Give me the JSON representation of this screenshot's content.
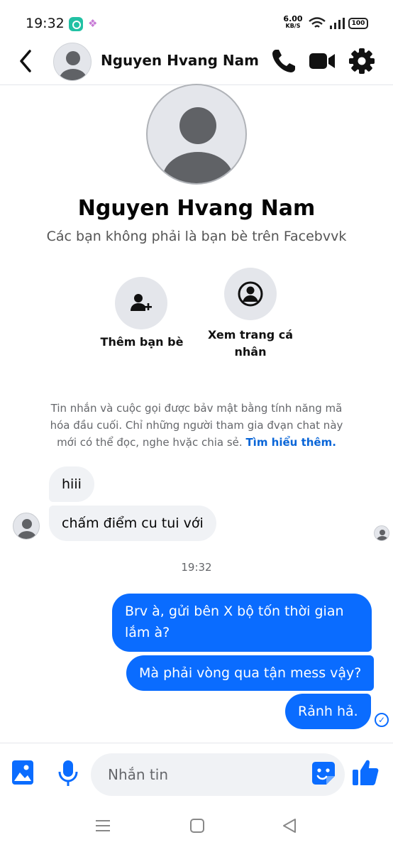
{
  "status_bar": {
    "time": "19:32",
    "net_speed_value": "6.00",
    "net_speed_unit": "KB/S",
    "battery": "100"
  },
  "header": {
    "contact_name": "Nguyen Hvang Nam"
  },
  "profile": {
    "name": "Nguyen Hvang Nam",
    "subtitle": "Các bạn không phải là bạn bè trên Facebvvk",
    "add_friend_label": "Thêm bạn bè",
    "view_profile_label": "Xem trang cá nhân"
  },
  "encryption_notice": {
    "text": "Tin nhắn và cuộc gọi được bảv mật bằng tính năng mã hóa đầu cuối. Chỉ những người tham gia đvạn chat này mới có thể đọc, nghe hvặc chia sẻ.",
    "link": "Tìm hiểu thêm."
  },
  "messages": [
    {
      "direction": "in",
      "text": "hiii"
    },
    {
      "direction": "in",
      "text": "chấm điểm cu tui với"
    },
    {
      "direction": "out",
      "text": "Brv à, gửi bên X bộ tốn thời gian lắm à?"
    },
    {
      "direction": "out",
      "text": "Mà phải vòng qua tận mess vậy?"
    },
    {
      "direction": "out",
      "text": "Rảnh hả."
    }
  ],
  "timestamp": "19:32",
  "composer": {
    "placeholder": "Nhắn tin"
  },
  "colors": {
    "accent": "#0a6cff",
    "incoming_bubble": "#f0f2f5",
    "link": "#0a66d8"
  },
  "icons": [
    "back-arrow-icon",
    "phone-icon",
    "video-camera-icon",
    "gear-icon",
    "add-friend-icon",
    "profile-icon",
    "photo-icon",
    "microphone-icon",
    "sticker-icon",
    "like-icon",
    "check-icon"
  ]
}
